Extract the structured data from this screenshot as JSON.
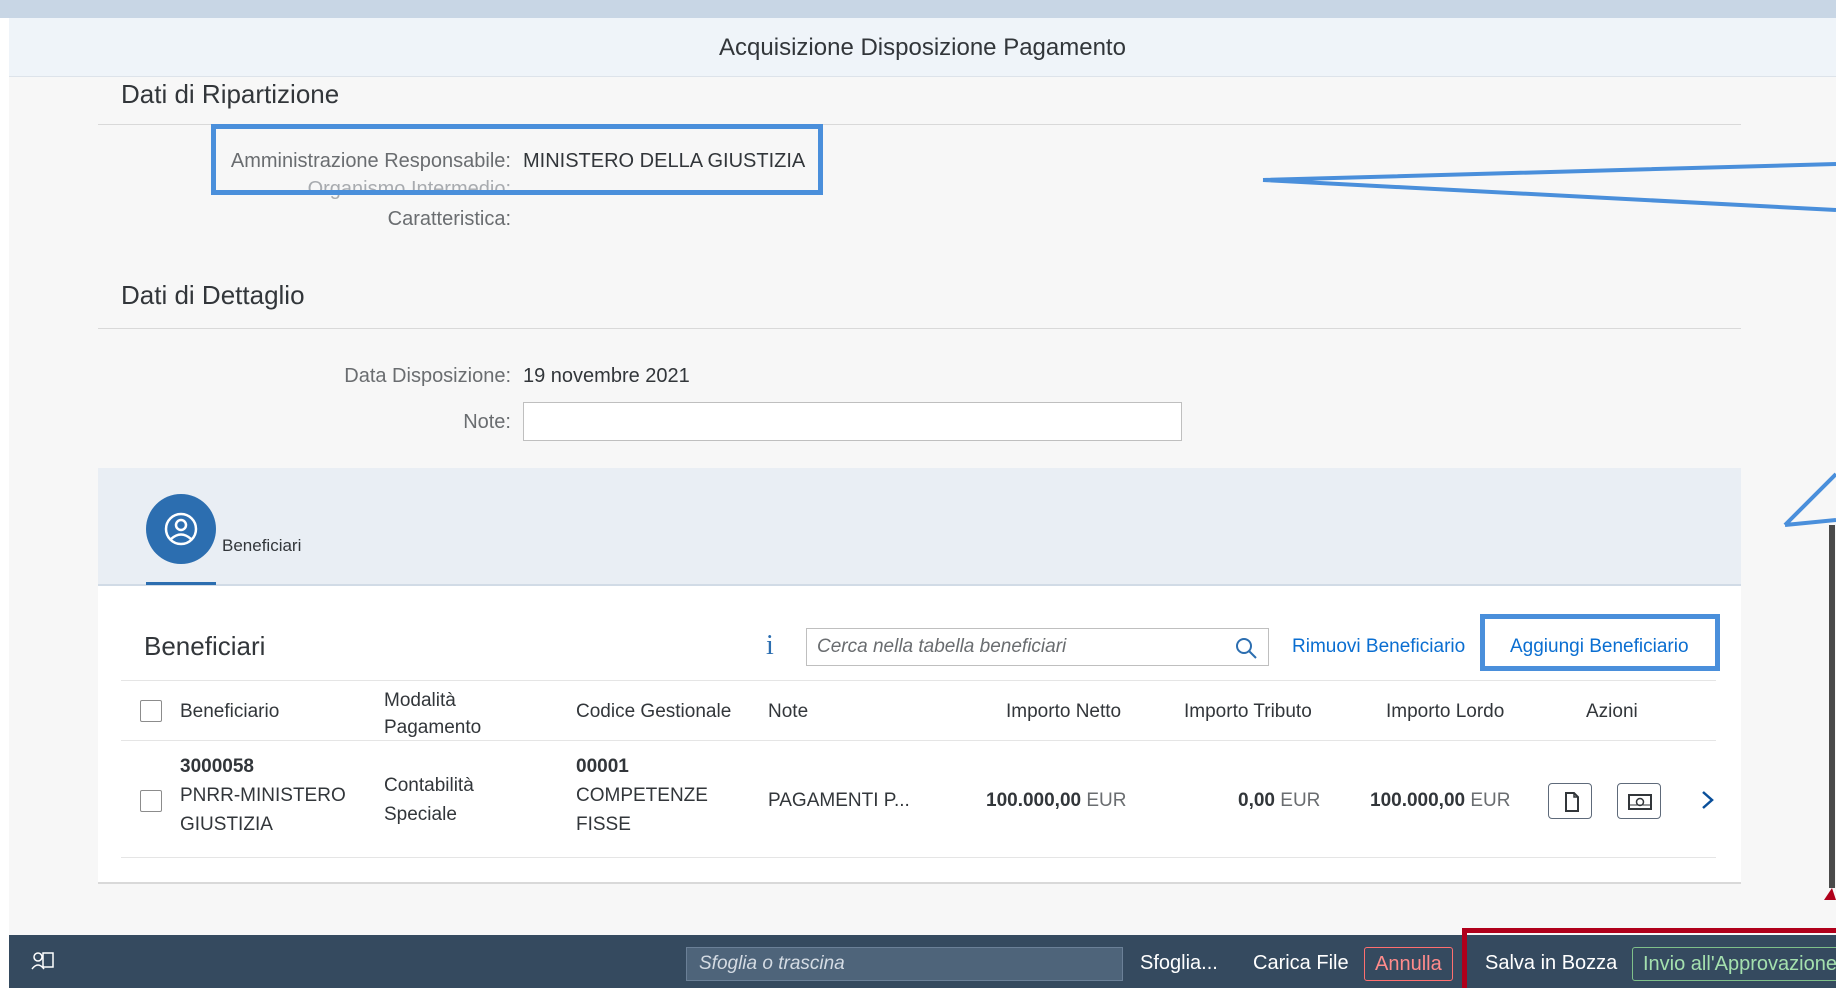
{
  "window": {
    "title": "Acquisizione Disposizione Pagamento"
  },
  "ripartizione": {
    "section_title": "Dati di Ripartizione",
    "amministrazione_label": "Amministrazione Responsabile:",
    "amministrazione_value": "MINISTERO DELLA GIUSTIZIA",
    "organismo_label": "Organismo Intermedio:",
    "caratteristica_label": "Caratteristica:"
  },
  "dettaglio": {
    "section_title": "Dati di Dettaglio",
    "data_label": "Data Disposizione:",
    "data_value": "19 novembre 2021",
    "note_label": "Note:",
    "note_value": ""
  },
  "tabs": [
    {
      "label": "Beneficiari",
      "icon": "user-circle-icon",
      "selected": true
    }
  ],
  "table": {
    "title": "Beneficiari",
    "search_placeholder": "Cerca nella tabella beneficiari",
    "remove_label": "Rimuovi Beneficiario",
    "add_label": "Aggiungi Beneficiario",
    "columns": [
      "Beneficiario",
      "Modalità Pagamento",
      "Codice Gestionale",
      "Note",
      "Importo Netto",
      "Importo Tributo",
      "Importo Lordo",
      "Azioni"
    ],
    "col_modalita_l1": "Modalità",
    "col_modalita_l2": "Pagamento",
    "rows": [
      {
        "beneficiario_code": "3000058",
        "beneficiario_name_l1": "PNRR-MINISTERO",
        "beneficiario_name_l2": "GIUSTIZIA",
        "modalita_l1": "Contabilità",
        "modalita_l2": "Speciale",
        "codice": "00001",
        "codice_desc_l1": "COMPETENZE",
        "codice_desc_l2": "FISSE",
        "note": "PAGAMENTI P...",
        "netto": "100.000,00",
        "tributo": "0,00",
        "lordo": "100.000,00",
        "currency": "EUR"
      }
    ]
  },
  "footer": {
    "file_placeholder": "Sfoglia o trascina",
    "browse_label": "Sfoglia...",
    "upload_label": "Carica File",
    "cancel_label": "Annulla",
    "draft_label": "Salva in Bozza",
    "submit_label": "Invio all'Approvazione"
  },
  "colors": {
    "accent": "#0a6ed1",
    "highlight_blue": "#4a8fdb",
    "highlight_red": "#b0001b",
    "shell": "#354a5f"
  }
}
